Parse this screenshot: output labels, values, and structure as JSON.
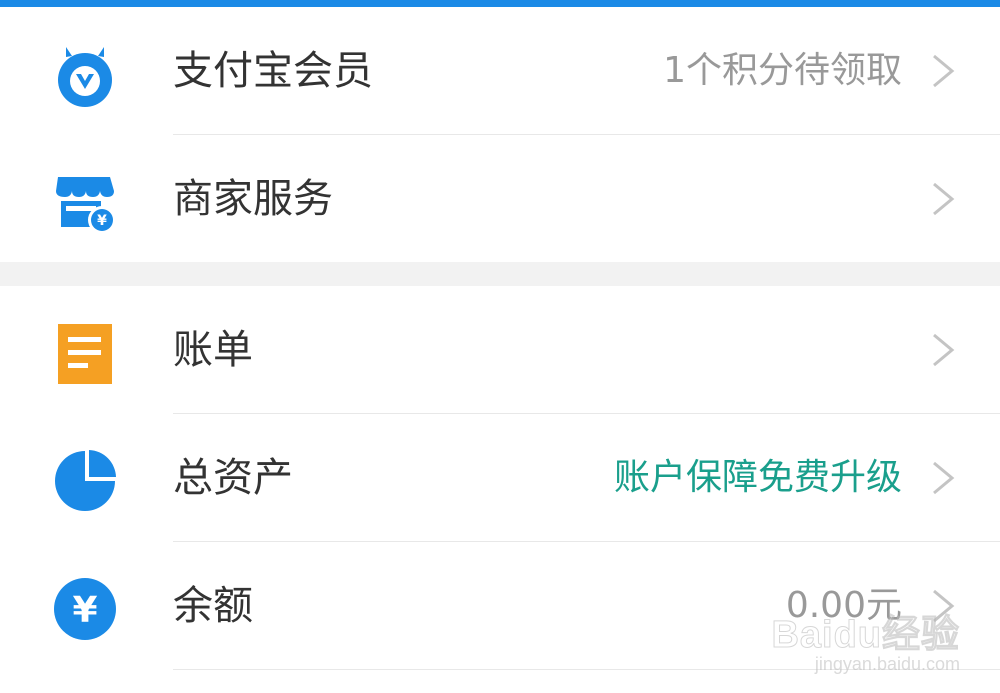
{
  "colors": {
    "top_bar": "#1b8ae6",
    "icon_blue": "#1b8ae6",
    "icon_orange": "#f5a023",
    "label_text": "#333333",
    "value_grey": "#999999",
    "value_accent": "#1a9f8c",
    "section_gap": "#f2f2f2"
  },
  "menu": {
    "group1": [
      {
        "label": "支付宝会员",
        "value": "1个积分待领取",
        "icon": "membership-badge-icon"
      },
      {
        "label": "商家服务",
        "value": "",
        "icon": "merchant-store-icon"
      }
    ],
    "group2": [
      {
        "label": "账单",
        "value": "",
        "icon": "bill-document-icon"
      },
      {
        "label": "总资产",
        "value": "账户保障免费升级",
        "icon": "pie-chart-icon"
      },
      {
        "label": "余额",
        "value": "0.00元",
        "icon": "yuan-coin-icon"
      }
    ]
  },
  "watermark": {
    "brand": "Baidu经验",
    "url": "jingyan.baidu.com"
  }
}
